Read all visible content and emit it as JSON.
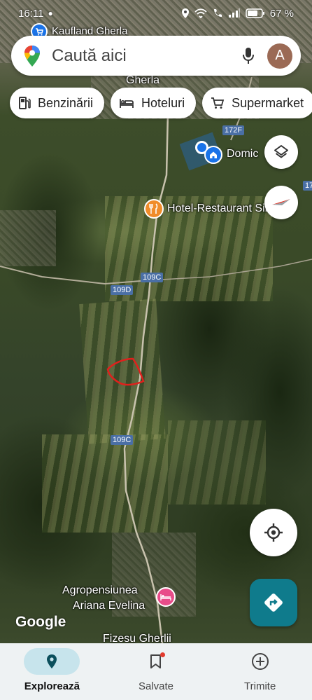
{
  "status_bar": {
    "time": "16:11",
    "battery": "67 %"
  },
  "search": {
    "placeholder": "Caută aici",
    "avatar_letter": "A"
  },
  "chips": [
    {
      "label": "Benzinării",
      "icon": "gas-station-icon"
    },
    {
      "label": "Hoteluri",
      "icon": "bed-icon"
    },
    {
      "label": "Supermarket",
      "icon": "shopping-cart-icon"
    }
  ],
  "map": {
    "labels": {
      "kaufland": "Kaufland Gherla",
      "gherla": "Gherla",
      "domicile": "Domic",
      "hotel": "Hotel-Restaurant Simon",
      "agro_line1": "Agropensiunea",
      "agro_line2": "Ariana Evelina",
      "fizesu": "Fizesu Gherlii"
    },
    "routes": {
      "r172f": "172F",
      "r109c_a": "109C",
      "r109d": "109D",
      "r109c_b": "109C",
      "r17": "17"
    },
    "attribution": "Google",
    "colors": {
      "hotel": "#f08c2a",
      "lodging": "#e84d8a",
      "user_location": "#1a73e8",
      "sketch": "#e0201c"
    }
  },
  "bottom_nav": [
    {
      "label": "Explorează",
      "icon": "location-pin-icon",
      "active": true
    },
    {
      "label": "Salvate",
      "icon": "bookmark-icon",
      "active": false
    },
    {
      "label": "Trimite",
      "icon": "add-circle-icon",
      "active": false
    }
  ]
}
